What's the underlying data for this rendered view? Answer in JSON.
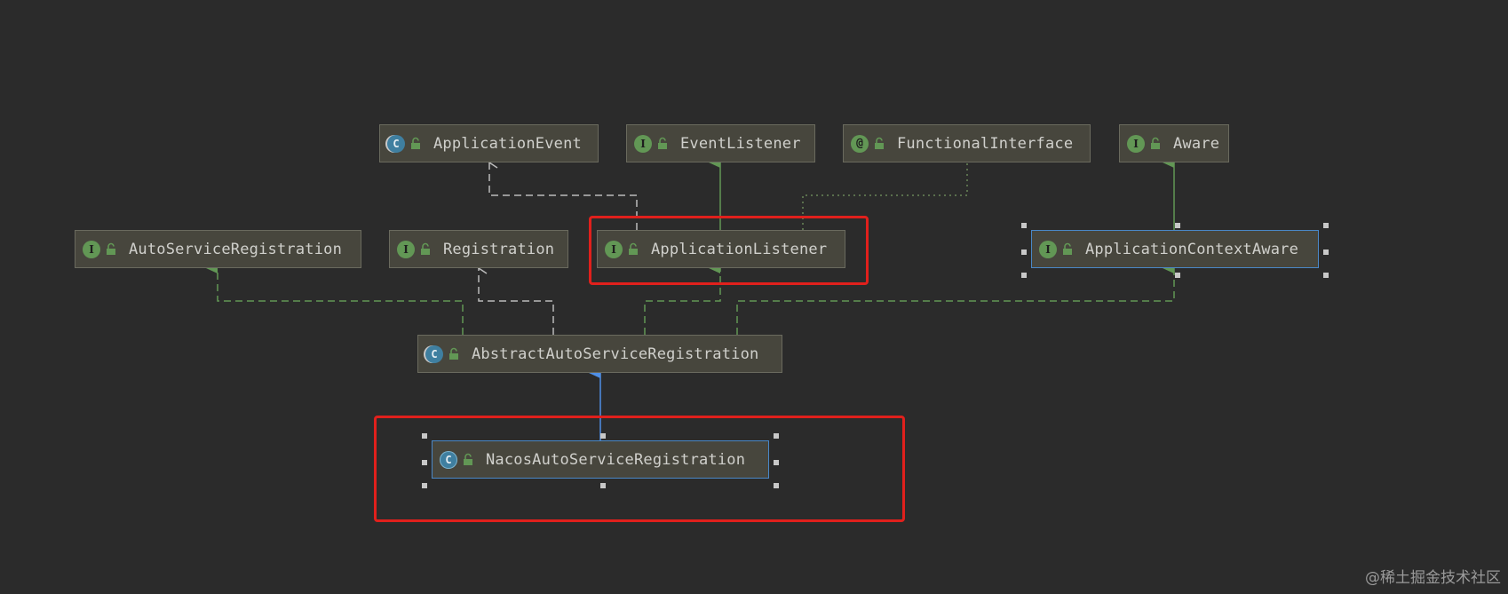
{
  "nodes": [
    {
      "id": "ApplicationEvent",
      "label": "ApplicationEvent",
      "kind": "abstract",
      "kind_glyph": "C",
      "icon": "abstract-class-icon",
      "selected": false
    },
    {
      "id": "EventListener",
      "label": "EventListener",
      "kind": "interface",
      "kind_glyph": "I",
      "icon": "interface-icon",
      "selected": false
    },
    {
      "id": "FunctionalInterface",
      "label": "FunctionalInterface",
      "kind": "annotation",
      "kind_glyph": "@",
      "icon": "annotation-icon",
      "selected": false
    },
    {
      "id": "Aware",
      "label": "Aware",
      "kind": "interface",
      "kind_glyph": "I",
      "icon": "interface-icon",
      "selected": false
    },
    {
      "id": "AutoServiceRegistration",
      "label": "AutoServiceRegistration",
      "kind": "interface",
      "kind_glyph": "I",
      "icon": "interface-icon",
      "selected": false
    },
    {
      "id": "Registration",
      "label": "Registration",
      "kind": "interface",
      "kind_glyph": "I",
      "icon": "interface-icon",
      "selected": false
    },
    {
      "id": "ApplicationListener",
      "label": "ApplicationListener",
      "kind": "interface",
      "kind_glyph": "I",
      "icon": "interface-icon",
      "selected": false
    },
    {
      "id": "ApplicationContextAware",
      "label": "ApplicationContextAware",
      "kind": "interface",
      "kind_glyph": "I",
      "icon": "interface-icon",
      "selected": true
    },
    {
      "id": "AbstractAutoServiceRegistration",
      "label": "AbstractAutoServiceRegistration",
      "kind": "abstract",
      "kind_glyph": "C",
      "icon": "abstract-class-icon",
      "selected": false
    },
    {
      "id": "NacosAutoServiceRegistration",
      "label": "NacosAutoServiceRegistration",
      "kind": "class",
      "kind_glyph": "C",
      "icon": "class-icon",
      "selected": true
    }
  ],
  "edges": [
    {
      "from": "ApplicationListener",
      "to": "ApplicationEvent",
      "type": "uses"
    },
    {
      "from": "ApplicationListener",
      "to": "EventListener",
      "type": "extends"
    },
    {
      "from": "ApplicationListener",
      "to": "FunctionalInterface",
      "type": "annotated"
    },
    {
      "from": "ApplicationContextAware",
      "to": "Aware",
      "type": "extends"
    },
    {
      "from": "AbstractAutoServiceRegistration",
      "to": "AutoServiceRegistration",
      "type": "implements"
    },
    {
      "from": "AbstractAutoServiceRegistration",
      "to": "Registration",
      "type": "uses"
    },
    {
      "from": "AbstractAutoServiceRegistration",
      "to": "ApplicationListener",
      "type": "implements"
    },
    {
      "from": "AbstractAutoServiceRegistration",
      "to": "ApplicationContextAware",
      "type": "implements"
    },
    {
      "from": "NacosAutoServiceRegistration",
      "to": "AbstractAutoServiceRegistration",
      "type": "extends-class"
    }
  ],
  "colors": {
    "background": "#2b2b2b",
    "interface_edge": "#629755",
    "class_edge": "#4f8fe6",
    "usage_edge": "#bbbbbb",
    "annotation_edge": "#6a8759",
    "highlight": "#e0201c",
    "selection": "#4a88c7"
  },
  "watermark": "@稀土掘金技术社区"
}
